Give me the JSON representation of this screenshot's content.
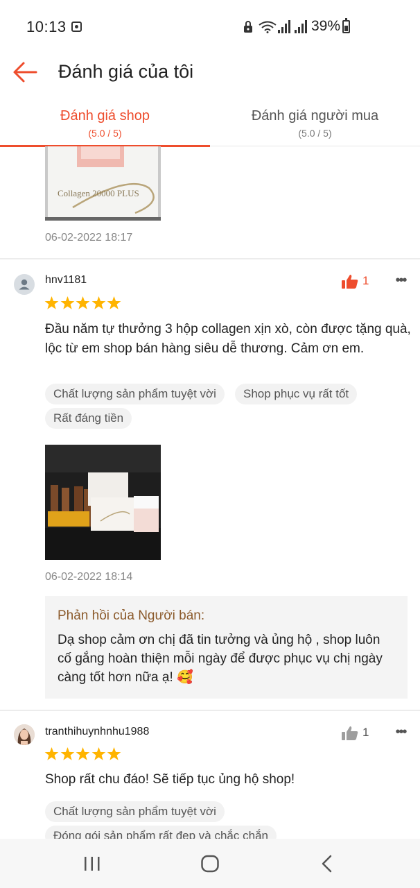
{
  "status_bar": {
    "time": "10:13",
    "battery": "39%"
  },
  "header": {
    "title": "Đánh giá của tôi"
  },
  "tabs": [
    {
      "label": "Đánh giá shop",
      "sub": "(5.0 / 5)",
      "active": true
    },
    {
      "label": "Đánh giá người mua",
      "sub": "(5.0 / 5)",
      "active": false
    }
  ],
  "colors": {
    "accent": "#ee4d2d",
    "star": "#ffb400",
    "reply_title": "#8b5a2b"
  },
  "top_review": {
    "photo_text": "Collagen 20000 PLUS",
    "date": "06-02-2022 18:17"
  },
  "reviews": [
    {
      "username": "hnv1181",
      "likes": "1",
      "rating": 5,
      "text": "Đầu năm tự thưởng 3 hộp collagen xịn xò, còn được tặng quà, lộc từ em shop bán hàng siêu dễ thương. Cảm ơn em.",
      "tags": [
        "Chất lượng sản phẩm tuyệt vời",
        "Shop phục vụ rất tốt",
        "Rất đáng tiền"
      ],
      "date": "06-02-2022 18:14",
      "reply_title": "Phản hồi của Người bán:",
      "reply_text": "Dạ shop cảm ơn chị đã tin tưởng và ủng hộ , shop luôn cố gắng hoàn thiện mỗi ngày để được phục vụ chị ngày càng tốt hơn nữa ạ! 🥰"
    },
    {
      "username": "tranthihuynhnhu1988",
      "likes": "1",
      "rating": 5,
      "text": "Shop rất chu đáo! Sẽ tiếp tục ủng hộ shop!",
      "tags": [
        "Chất lượng sản phẩm tuyệt vời",
        "Đóng gói sản phẩm rất đẹp và chắc chắn"
      ]
    }
  ]
}
